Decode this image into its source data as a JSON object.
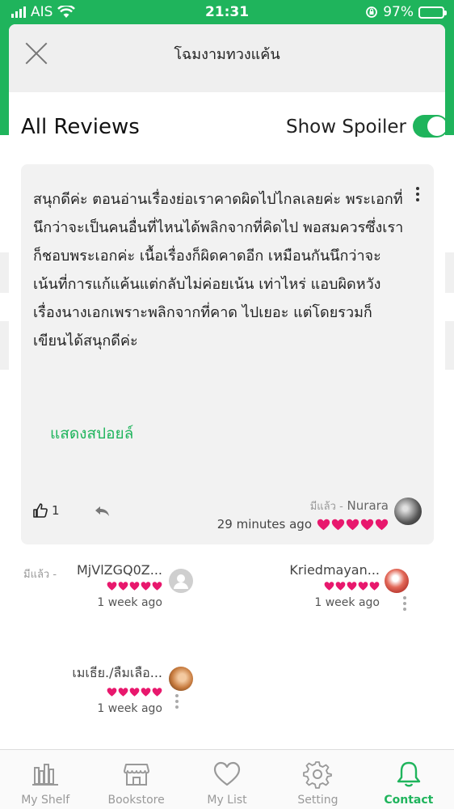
{
  "status_bar": {
    "carrier": "AIS",
    "time": "21:31",
    "battery": "97%"
  },
  "sheet": {
    "title": "โฉมงามทวงแค้น"
  },
  "reviews_header": {
    "title": "All Reviews",
    "spoiler_label": "Show Spoiler",
    "spoiler_on": true
  },
  "main_review": {
    "text": "สนุกดีค่ะ ตอนอ่านเรื่องย่อเราคาดผิดไปไกลเลยค่ะ พระเอกที่นึกว่าจะเป็นคนอื่นที่ไหนได้พลิกจากที่คิดไป พอสมควรซึ่งเราก็ชอบพระเอกค่ะ เนื้อเรื่องก็ผิดคาดอีก เหมือนกันนึกว่าจะเน้นที่การแก้แค้นแต่กลับไม่ค่อยเน้น เท่าไหร่ แอบผิดหวังเรื่องนางเอกเพราะพลิกจากที่คาด ไปเยอะ แต่โดยรวมก็เขียนได้สนุกดีค่ะ",
    "spoiler_link": "แสดงสปอยล์",
    "likes": "1",
    "status": "มีแล้ว -",
    "author": "Nurara",
    "time": "29 minutes ago",
    "rating": 5
  },
  "other_reviews": [
    {
      "status": "มีแล้ว -",
      "name": "MjVlZGQ0Z...",
      "time": "1 week ago",
      "rating": 5
    },
    {
      "status": "",
      "name": "Kriedmayan...",
      "time": "1 week ago",
      "rating": 5
    },
    {
      "status": "",
      "name": "เมเธีย./ลืมเลือ...",
      "time": "1 week ago",
      "rating": 5
    }
  ],
  "tabs": [
    {
      "label": "My Shelf",
      "icon": "shelf-icon",
      "active": false
    },
    {
      "label": "Bookstore",
      "icon": "store-icon",
      "active": false
    },
    {
      "label": "My List",
      "icon": "heart-icon",
      "active": false
    },
    {
      "label": "Setting",
      "icon": "gear-icon",
      "active": false
    },
    {
      "label": "Contact",
      "icon": "bell-icon",
      "active": true
    }
  ],
  "colors": {
    "accent": "#1fb45c",
    "heart": "#e8186d"
  }
}
